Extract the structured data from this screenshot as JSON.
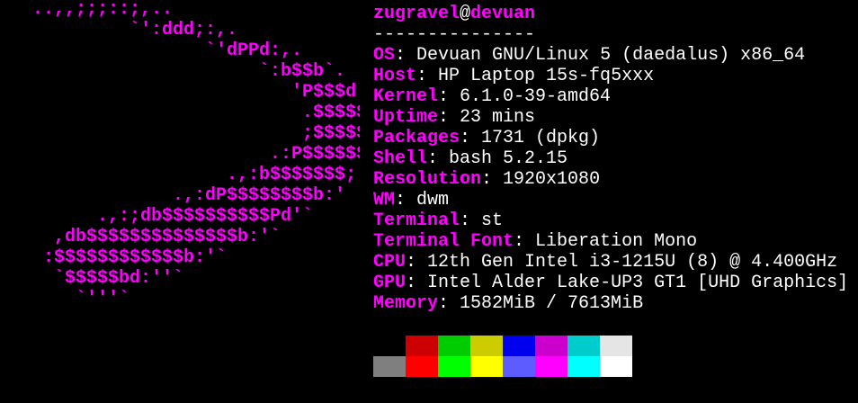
{
  "logo": {
    "lines": [
      "   ..,,;;;::;,..",
      "            `':ddd;:,.",
      "                   `'dPPd:,.",
      "                        `:b$$b`.",
      "                           'P$$$d`",
      "                            .$$$$$`",
      "                            ;$$$$$P",
      "                         .:P$$$$$$`",
      "                     .,:b$$$$$$$;'",
      "                .,:dP$$$$$$$$b:'",
      "         .,:;db$$$$$$$$$$Pd'`",
      "     ,db$$$$$$$$$$$$$$b:'`",
      "    :$$$$$$$$$$$$b:'`",
      "     `$$$$$bd:''`",
      "       `'''`"
    ],
    "color": "#ff00ff"
  },
  "header": {
    "user": "zugravel",
    "at": "@",
    "host": "devuan",
    "separator": "---------------"
  },
  "info": [
    {
      "key": "OS",
      "value": "Devuan GNU/Linux 5 (daedalus) x86_64"
    },
    {
      "key": "Host",
      "value": "HP Laptop 15s-fq5xxx"
    },
    {
      "key": "Kernel",
      "value": "6.1.0-39-amd64"
    },
    {
      "key": "Uptime",
      "value": "23 mins"
    },
    {
      "key": "Packages",
      "value": "1731 (dpkg)"
    },
    {
      "key": "Shell",
      "value": "bash 5.2.15"
    },
    {
      "key": "Resolution",
      "value": "1920x1080"
    },
    {
      "key": "WM",
      "value": "dwm"
    },
    {
      "key": "Terminal",
      "value": "st"
    },
    {
      "key": "Terminal Font",
      "value": "Liberation Mono"
    },
    {
      "key": "CPU",
      "value": "12th Gen Intel i3-1215U (8) @ 4.400GHz"
    },
    {
      "key": "GPU",
      "value": "Intel Alder Lake-UP3 GT1 [UHD Graphics]"
    },
    {
      "key": "Memory",
      "value": "1582MiB / 7613MiB"
    }
  ],
  "colors": {
    "accent": "#ff00ff",
    "text": "#ffffff",
    "background": "#000000"
  },
  "palette": {
    "normal": [
      "#000000",
      "#cc0000",
      "#00cc00",
      "#cccc00",
      "#0000ee",
      "#cc00cc",
      "#00cccc",
      "#e5e5e5"
    ],
    "bright": [
      "#7f7f7f",
      "#ff0000",
      "#00ff00",
      "#ffff00",
      "#5c5cff",
      "#ff00ff",
      "#00ffff",
      "#ffffff"
    ]
  }
}
